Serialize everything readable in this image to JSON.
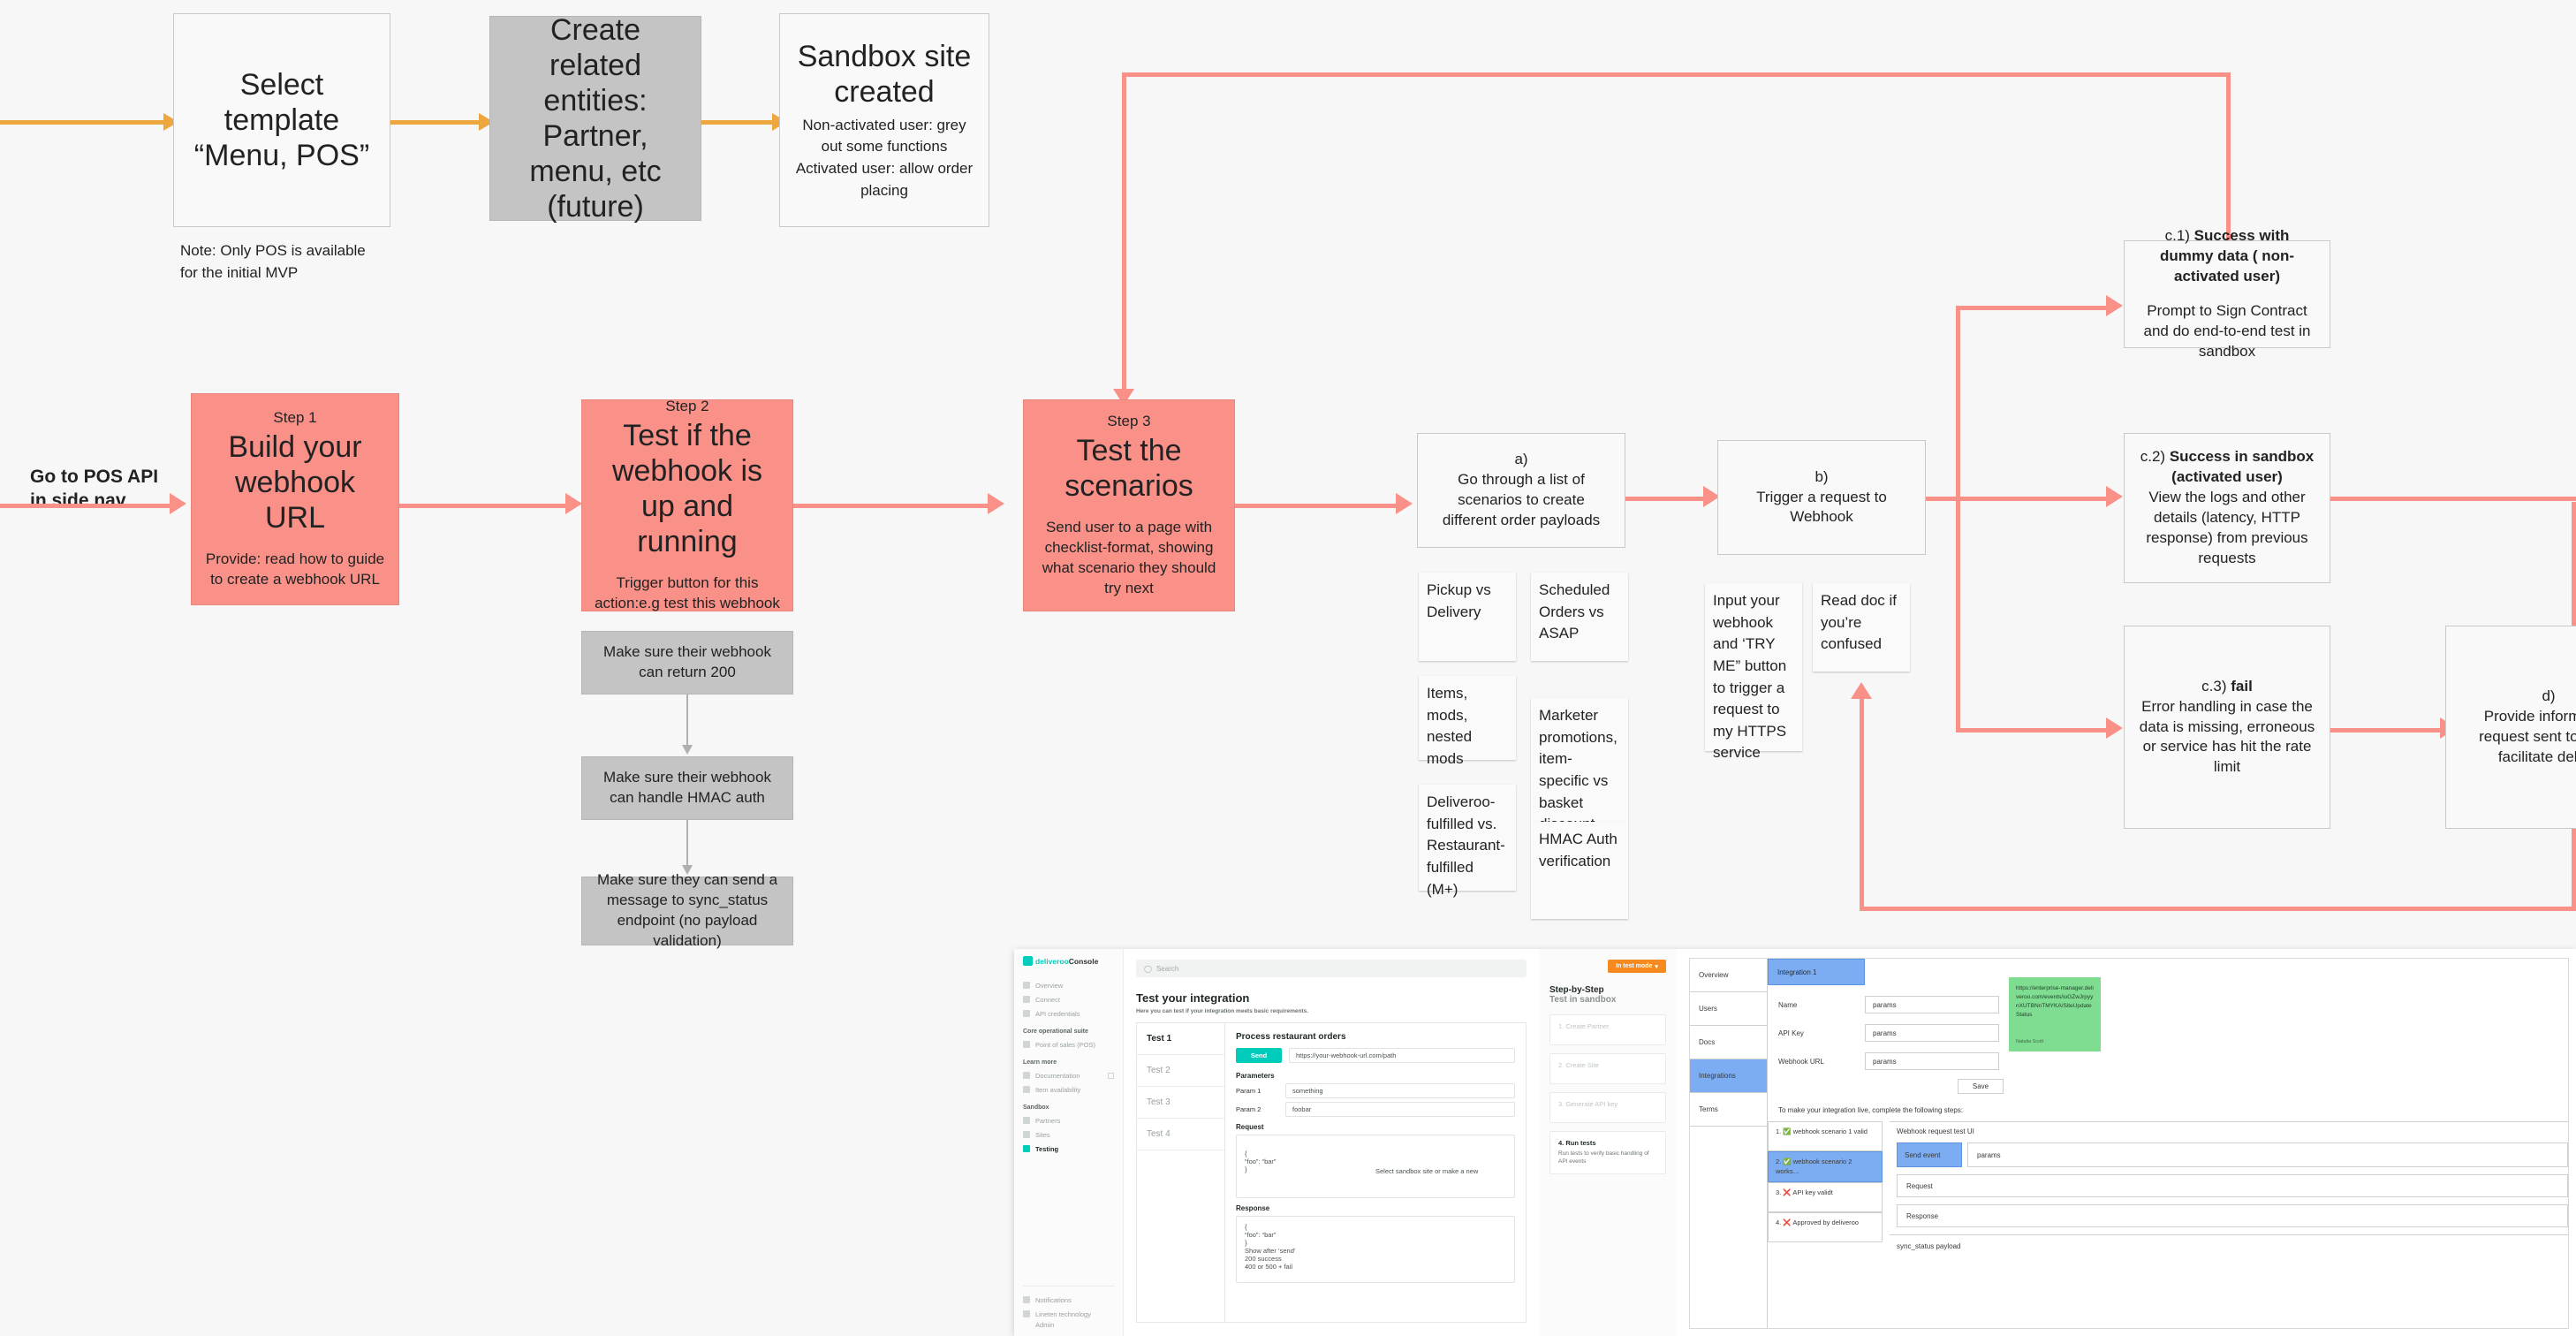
{
  "diagram": {
    "title": "POS sandbox / webhook testing flow",
    "colors": {
      "accent_red": "#fa9189",
      "accent_orange": "#eda73e",
      "gray_box": "#c4c4c4",
      "sticky_green": "#7fdd92",
      "brand_teal": "#00ccbc",
      "test_mode_orange": "#f68a1f",
      "wireframe_blue": "#7cacf2"
    }
  },
  "top_flow": {
    "select_template": {
      "text": "Select template\n“Menu, POS”"
    },
    "note": {
      "text": "Note: Only POS is available for the initial MVP"
    },
    "create_entities": {
      "text": "Create related entities: Partner, menu, etc (future)"
    },
    "sandbox_site": {
      "title": "Sandbox site created",
      "line1": "Non-activated user: grey out some functions",
      "line2": "Activated user: allow order placing"
    }
  },
  "entry_label": {
    "text": "Go to POS API\nin side nav"
  },
  "steps": [
    {
      "step": "Step 1",
      "title": "Build your webhook URL",
      "note": "Provide: read how to guide to create a webhook URL"
    },
    {
      "step": "Step 2",
      "title": "Test if the webhook is up and running",
      "note": "Trigger button for this action:e.g test this webhook"
    },
    {
      "step": "Step 3",
      "title": "Test the scenarios",
      "note": "Send user to a page with checklist-format, showing what scenario they should try next"
    }
  ],
  "step2_checks": [
    "Make sure their webhook can return 200",
    "Make sure their webhook can handle HMAC auth",
    "Make sure they can send a message to sync_status endpoint (no payload validation)"
  ],
  "branch_a": {
    "label": "a)",
    "text": "Go through a list of scenarios to create different order payloads",
    "cards_left": [
      "Pickup vs Delivery",
      " Items, mods, nested mods",
      "Deliveroo-fulfilled vs. Restaurant-fulfilled (M+)"
    ],
    "cards_right": [
      "Scheduled Orders vs ASAP",
      "Marketer promotions, item-specific vs basket discount",
      "HMAC Auth verification"
    ]
  },
  "branch_b": {
    "label": "b)",
    "text": "Trigger a request to Webhook",
    "cards": [
      "Input your webhook and ‘TRY ME” button to trigger a request to my HTTPS service",
      "Read doc if you’re confused"
    ]
  },
  "outcomes": {
    "c1": {
      "label": "c.1)",
      "title_bold": "Success with dummy data ( non-activated user)",
      "body": "Prompt to Sign Contract and do end-to-end test in sandbox"
    },
    "c2": {
      "label": "c.2)",
      "title_bold": "Success in sandbox (activated user)",
      "body": "View the logs and other details (latency, HTTP response) from previous requests"
    },
    "c3": {
      "label": "c.3)",
      "title_bold": "fail",
      "body": "Error handling in case the data is missing, erroneous or service has hit the rate limit"
    },
    "d": {
      "label": "d)",
      "body": "Provide information request sent to the w facilitate debug"
    }
  },
  "mock": {
    "brand": "deliveroo",
    "brand_suffix": "Console",
    "search_placeholder": "Search",
    "nav": [
      {
        "label": "Overview",
        "active": false
      },
      {
        "label": "Connect",
        "active": false
      },
      {
        "label": "API credentials",
        "active": false
      }
    ],
    "nav_group_core": "Core operational suite",
    "nav_core": [
      {
        "label": "Point of sales (POS)",
        "active": false
      }
    ],
    "nav_group_learn": "Learn more",
    "nav_learn": [
      {
        "label": "Documentation",
        "active": false,
        "external": true
      },
      {
        "label": "Item availability",
        "active": false
      }
    ],
    "nav_group_sandbox": "Sandbox",
    "nav_sandbox": [
      {
        "label": "Partners",
        "active": false
      },
      {
        "label": "Sites",
        "active": false
      },
      {
        "label": "Testing",
        "active": true
      }
    ],
    "nav_footer": [
      {
        "label": "Notifications"
      },
      {
        "label": "Lineten technology"
      },
      {
        "label": "Admin"
      }
    ],
    "page_title": "Test your integration",
    "page_sub": "Here you can test if your integration meets basic requirements.",
    "tests": [
      {
        "label": "Test 1",
        "active": true
      },
      {
        "label": "Test 2",
        "active": false
      },
      {
        "label": "Test 3",
        "active": false
      },
      {
        "label": "Test 4",
        "active": false
      }
    ],
    "detail_title": "Process restaurant orders",
    "send_label": "Send",
    "url_value": "https://your-webhook-url.com/path",
    "parameters_label": "Parameters",
    "params": [
      {
        "name": "Param 1",
        "value": "something"
      },
      {
        "name": "Param 2",
        "value": "foobar"
      }
    ],
    "request_label": "Request",
    "request_body": "{\n  “foo”: “bar”\n}",
    "request_hint": "Select sandbox site or make a new",
    "response_label": "Response",
    "response_body": "{\n  “foo”: “bar”\n}\n Show after ‘send’\n 200 success\n 400 or 500 + fail",
    "test_mode_label": "In test mode",
    "step_title": "Step-by-Step",
    "step_subtitle": "Test in sandbox",
    "step_cards": [
      {
        "title": "1. Create Partner",
        "desc": "",
        "done": false
      },
      {
        "title": "2. Create Site",
        "desc": "",
        "done": false
      },
      {
        "title": "3. Generate API key",
        "desc": "",
        "done": false
      },
      {
        "title": "4. Run tests",
        "desc": "Run tests to verify basic handling of API events",
        "done": true
      }
    ]
  },
  "wireframe": {
    "nav": [
      {
        "label": "Overview",
        "selected": false
      },
      {
        "label": "Users",
        "selected": false
      },
      {
        "label": "Docs",
        "selected": false
      },
      {
        "label": "Integrations",
        "selected": true
      },
      {
        "label": "Terms",
        "selected": false
      }
    ],
    "tab": "Integration 1",
    "fields": [
      {
        "name": "Name",
        "value": "params"
      },
      {
        "name": "API Key",
        "value": "params"
      },
      {
        "name": "Webhook URL",
        "value": "params"
      }
    ],
    "save_label": "Save",
    "note": "To make your integration live, complete the following steps:",
    "checklist": [
      {
        "text": "1. ✅ webhook scenario 1 valid",
        "selected": false
      },
      {
        "text": "2. ✅ webhook scenario 2 works…",
        "selected": true
      },
      {
        "text": "3. ❌ API key validt",
        "selected": false
      },
      {
        "text": "4. ❌ Approved by deliveroo",
        "selected": false
      }
    ],
    "right_title": "Webhook request test UI",
    "send_event_label": "Send event",
    "send_event_value": "params",
    "request_label": "Request",
    "response_label": "Response",
    "sync_label": "sync_status payload"
  },
  "sticky_note": {
    "url": "https://enterprise-manager.deliveroo.com/events/iuGZwJrpyynXUTBNnTMYKA/SiteUpdateStatus",
    "author": "Natalia Scott"
  }
}
